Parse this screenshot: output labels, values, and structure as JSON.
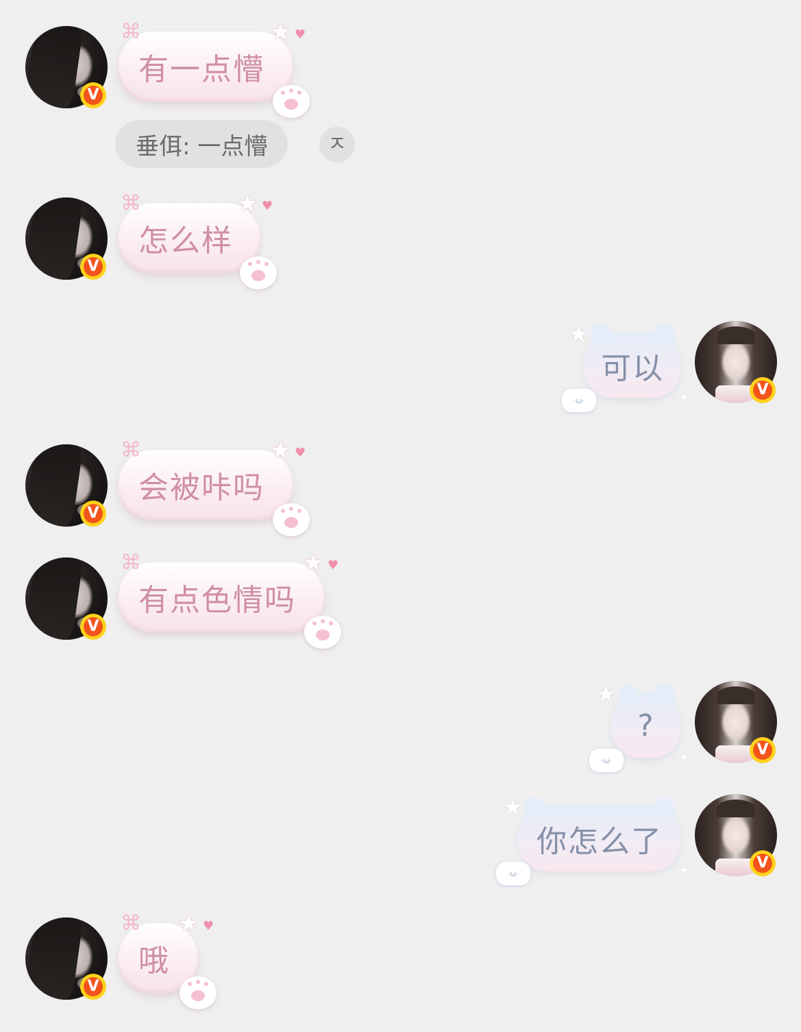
{
  "messages": [
    {
      "side": "left",
      "text": "有一点懵"
    },
    {
      "side": "left",
      "text": "怎么样"
    },
    {
      "side": "right",
      "text": "可以"
    },
    {
      "side": "left",
      "text": "会被咔吗"
    },
    {
      "side": "left",
      "text": "有点色情吗"
    },
    {
      "side": "right",
      "text": "?"
    },
    {
      "side": "right",
      "text": "你怎么了"
    },
    {
      "side": "left",
      "text": "哦"
    }
  ],
  "translation": {
    "text": "垂佴: 一点懵",
    "collapse_icon": "collapse-arrow-icon",
    "collapse_glyph": "ㅈ"
  },
  "badge": {
    "label": "V",
    "color": "#f2541b"
  },
  "decor": {
    "cat_face": "·ω·"
  }
}
